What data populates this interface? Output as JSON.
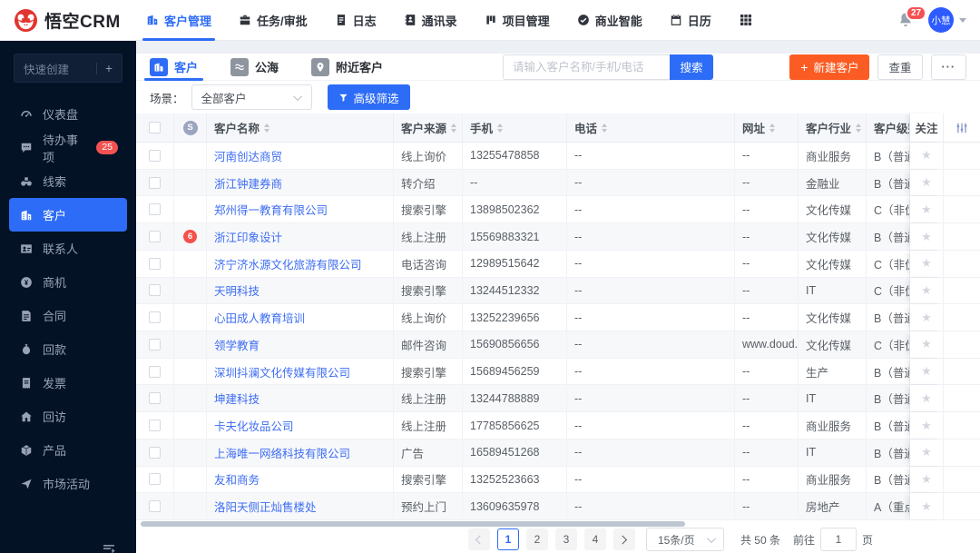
{
  "brand": {
    "name": "悟空CRM"
  },
  "topnav": {
    "items": [
      {
        "label": "客户管理",
        "icon": "customer-management-icon",
        "active": true
      },
      {
        "label": "任务/审批",
        "icon": "tasks-approval-icon"
      },
      {
        "label": "日志",
        "icon": "log-icon"
      },
      {
        "label": "通讯录",
        "icon": "address-book-icon"
      },
      {
        "label": "项目管理",
        "icon": "project-management-icon"
      },
      {
        "label": "商业智能",
        "icon": "business-intelligence-icon"
      },
      {
        "label": "日历",
        "icon": "calendar-icon"
      }
    ],
    "notification_count": "27",
    "avatar_name": "小慧"
  },
  "sidebar": {
    "quick_create_label": "快速创建",
    "items": [
      {
        "label": "仪表盘",
        "icon": "dashboard-icon"
      },
      {
        "label": "待办事项",
        "icon": "todo-icon",
        "badge": "25"
      },
      {
        "label": "线索",
        "icon": "leads-icon"
      },
      {
        "label": "客户",
        "icon": "customer-icon",
        "active": true
      },
      {
        "label": "联系人",
        "icon": "contacts-icon"
      },
      {
        "label": "商机",
        "icon": "opportunity-icon"
      },
      {
        "label": "合同",
        "icon": "contract-icon"
      },
      {
        "label": "回款",
        "icon": "payment-icon"
      },
      {
        "label": "发票",
        "icon": "invoice-icon"
      },
      {
        "label": "回访",
        "icon": "visit-icon"
      },
      {
        "label": "产品",
        "icon": "product-icon"
      },
      {
        "label": "市场活动",
        "icon": "campaign-icon"
      }
    ]
  },
  "tabs": [
    {
      "label": "客户",
      "icon": "customer-tab-icon",
      "active": true
    },
    {
      "label": "公海",
      "icon": "public-pool-icon"
    },
    {
      "label": "附近客户",
      "icon": "nearby-customers-icon"
    }
  ],
  "toolbar": {
    "search_placeholder": "请输入客户名称/手机/电话",
    "search_button": "搜索",
    "new_customer_button": "新建客户",
    "new_customer_plus": "+",
    "dedupe_button": "查重",
    "more_button": "···"
  },
  "filter": {
    "scene_label": "场景：",
    "scene_value": "全部客户",
    "advanced_filter_button": "高级筛选"
  },
  "table": {
    "header_badge": "S",
    "columns": [
      {
        "label": "客户名称",
        "sortable": true
      },
      {
        "label": "客户来源",
        "sortable": true
      },
      {
        "label": "手机",
        "sortable": true
      },
      {
        "label": "电话",
        "sortable": true
      },
      {
        "label": "网址",
        "sortable": true
      },
      {
        "label": "客户行业",
        "sortable": true
      },
      {
        "label": "客户级别",
        "sortable": false
      },
      {
        "label": "关注",
        "sortable": false
      }
    ],
    "rows": [
      {
        "name": "河南创达商贸",
        "source": "线上询价",
        "mobile": "13255478858",
        "phone": "--",
        "website": "--",
        "industry": "商业服务",
        "level": "B（普通客"
      },
      {
        "name": "浙江钟建券商",
        "source": "转介绍",
        "mobile": "--",
        "phone": "--",
        "website": "--",
        "industry": "金融业",
        "level": "B（普通客"
      },
      {
        "name": "郑州得一教育有限公司",
        "source": "搜索引擎",
        "mobile": "13898502362",
        "phone": "--",
        "website": "--",
        "industry": "文化传媒",
        "level": "C（非优先"
      },
      {
        "name": "浙江印象设计",
        "badge": "6",
        "source": "线上注册",
        "mobile": "15569883321",
        "phone": "--",
        "website": "--",
        "industry": "文化传媒",
        "level": "B（普通客"
      },
      {
        "name": "济宁济水源文化旅游有限公司",
        "source": "电话咨询",
        "mobile": "12989515642",
        "phone": "--",
        "website": "--",
        "industry": "文化传媒",
        "level": "C（非优先"
      },
      {
        "name": "天明科技",
        "source": "搜索引擎",
        "mobile": "13244512332",
        "phone": "--",
        "website": "--",
        "industry": "IT",
        "level": "C（非优先"
      },
      {
        "name": "心田成人教育培训",
        "source": "线上询价",
        "mobile": "13252239656",
        "phone": "--",
        "website": "--",
        "industry": "文化传媒",
        "level": "B（普通客"
      },
      {
        "name": "领学教育",
        "source": "邮件咨询",
        "mobile": "15690856656",
        "phone": "--",
        "website": "www.doud...",
        "industry": "文化传媒",
        "level": "C（非优先"
      },
      {
        "name": "深圳抖澜文化传媒有限公司",
        "source": "搜索引擎",
        "mobile": "15689456259",
        "phone": "--",
        "website": "--",
        "industry": "生产",
        "level": "B（普通客"
      },
      {
        "name": "坤建科技",
        "source": "线上注册",
        "mobile": "13244788889",
        "phone": "--",
        "website": "--",
        "industry": "IT",
        "level": "B（普通客"
      },
      {
        "name": "卡夫化妆品公司",
        "source": "线上注册",
        "mobile": "17785856625",
        "phone": "--",
        "website": "--",
        "industry": "商业服务",
        "level": "B（普通客"
      },
      {
        "name": "上海唯一网络科技有限公司",
        "source": "广告",
        "mobile": "16589451268",
        "phone": "--",
        "website": "--",
        "industry": "IT",
        "level": "B（普通客"
      },
      {
        "name": "友和商务",
        "source": "搜索引擎",
        "mobile": "13252523663",
        "phone": "--",
        "website": "--",
        "industry": "商业服务",
        "level": "B（普通客"
      },
      {
        "name": "洛阳天侧正灿售楼处",
        "source": "预约上门",
        "mobile": "13609635978",
        "phone": "--",
        "website": "--",
        "industry": "房地产",
        "level": "A（重点客"
      }
    ]
  },
  "pagination": {
    "pages": [
      "1",
      "2",
      "3",
      "4"
    ],
    "current": "1",
    "page_size": "15条/页",
    "total": "共 50 条",
    "goto_label": "前往",
    "goto_value": "1",
    "goto_suffix": "页"
  },
  "colors": {
    "primary": "#2d6cf6",
    "brand_red": "#e23530",
    "orange": "#fb5c24",
    "danger": "#f45252",
    "sidebar_bg": "#041226"
  }
}
